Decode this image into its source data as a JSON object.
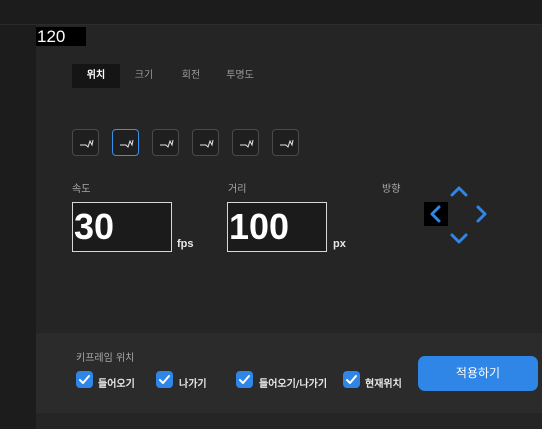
{
  "counter": "120",
  "tabs": [
    {
      "label": "위치",
      "active": true
    },
    {
      "label": "크기",
      "active": false
    },
    {
      "label": "회전",
      "active": false
    },
    {
      "label": "투명도",
      "active": false
    }
  ],
  "easing": {
    "count": 6,
    "selected_index": 1,
    "icon": "ease-curve-icon"
  },
  "speed": {
    "label": "속도",
    "value": "30",
    "unit": "fps"
  },
  "distance": {
    "label": "거리",
    "value": "100",
    "unit": "px"
  },
  "direction": {
    "label": "방향",
    "selected": "left",
    "icons": [
      "arrow-up-icon",
      "arrow-left-icon",
      "arrow-right-icon",
      "arrow-down-icon"
    ]
  },
  "keyframe": {
    "label": "키프레임 위치",
    "options": [
      {
        "label": "들어오기",
        "checked": true
      },
      {
        "label": "나가기",
        "checked": true
      },
      {
        "label": "들어오기/나가기",
        "checked": true
      },
      {
        "label": "현재위치",
        "checked": true
      }
    ]
  },
  "apply_label": "적용하기",
  "colors": {
    "accent": "#2f86e6",
    "panel": "#252525",
    "background": "#1c1c1c"
  }
}
